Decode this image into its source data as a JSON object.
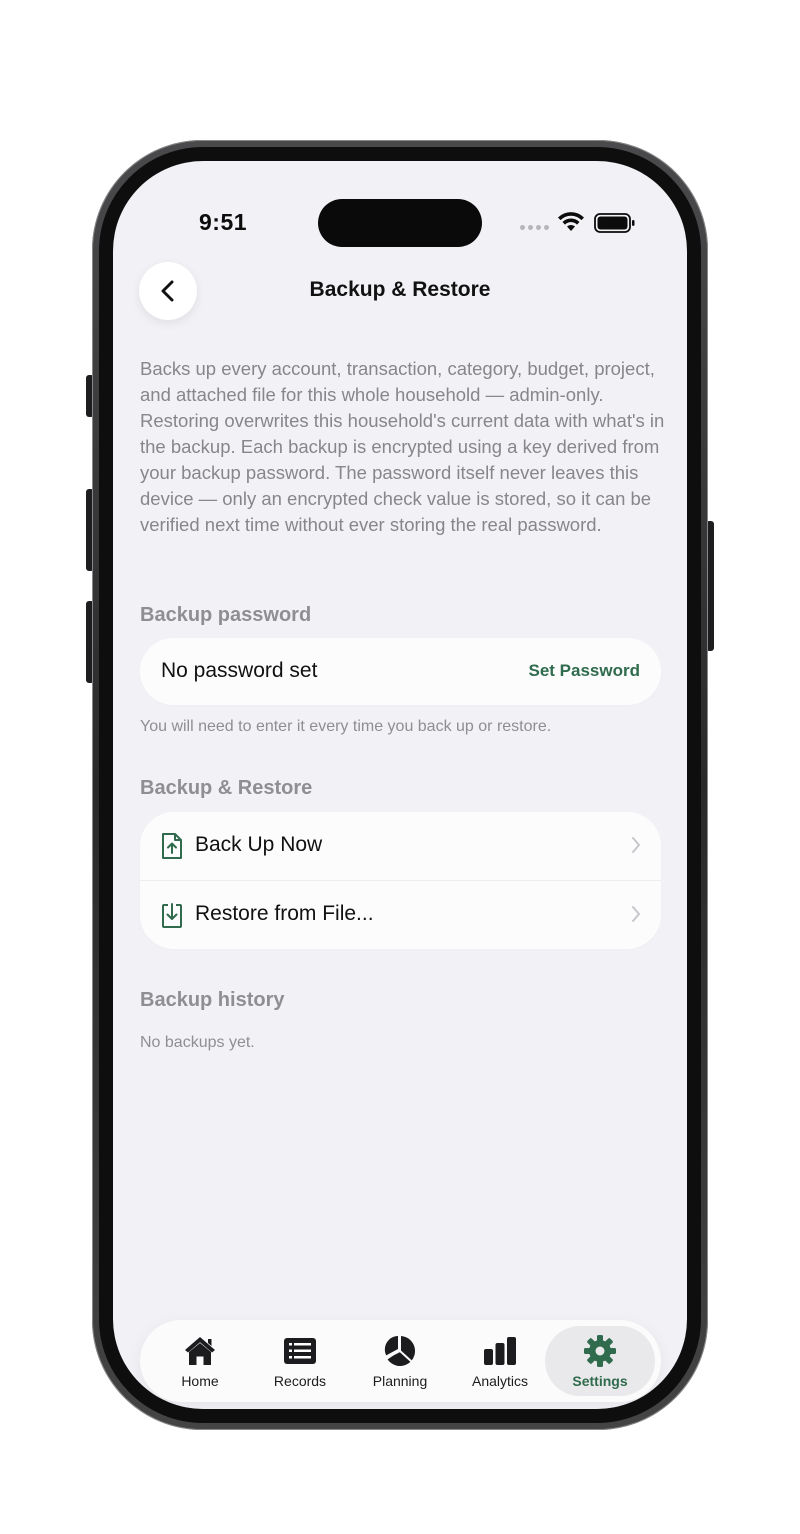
{
  "status_bar": {
    "time": "9:51"
  },
  "nav": {
    "title": "Backup & Restore"
  },
  "description": "Backs up every account, transaction, category, budget, project, and attached file for this whole household — admin-only. Restoring overwrites this household's current data with what's in the backup. Each backup is encrypted using a key derived from your backup password. The password itself never leaves this device — only an encrypted check value is stored, so it can be verified next time without ever storing the real password.",
  "password_section": {
    "title": "Backup password",
    "status": "No password set",
    "action_label": "Set Password",
    "hint": "You will need to enter it every time you back up or restore."
  },
  "backup_section": {
    "title": "Backup & Restore",
    "items": [
      {
        "label": "Back Up Now",
        "icon": "file-upload-icon"
      },
      {
        "label": "Restore from File...",
        "icon": "file-download-icon"
      }
    ]
  },
  "history_section": {
    "title": "Backup history",
    "empty_text": "No backups yet."
  },
  "tab_bar": {
    "tabs": [
      {
        "label": "Home",
        "icon": "home-icon"
      },
      {
        "label": "Records",
        "icon": "list-icon"
      },
      {
        "label": "Planning",
        "icon": "pie-chart-icon"
      },
      {
        "label": "Analytics",
        "icon": "bar-chart-icon"
      },
      {
        "label": "Settings",
        "icon": "gear-icon"
      }
    ],
    "active": "Settings"
  },
  "colors": {
    "accent": "#2f6b4c",
    "background": "#f2f2f6",
    "card": "#fcfcfd",
    "secondary_text": "#8e8e93"
  }
}
